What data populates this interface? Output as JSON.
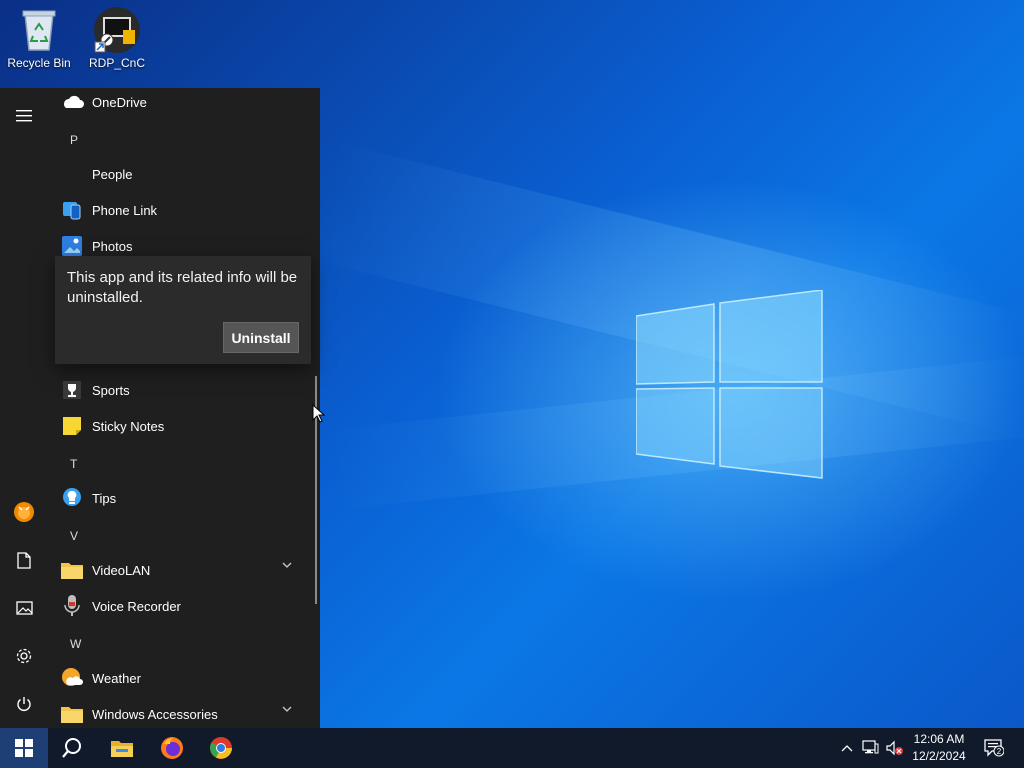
{
  "desktop": {
    "icons": [
      {
        "label": "Recycle Bin"
      },
      {
        "label": "RDP_CnC"
      }
    ]
  },
  "start_menu": {
    "items": {
      "onedrive": "OneDrive",
      "letter_p": "P",
      "people": "People",
      "phone_link": "Phone Link",
      "photos": "Photos",
      "sports": "Sports",
      "sticky_notes": "Sticky Notes",
      "letter_t": "T",
      "tips": "Tips",
      "letter_v": "V",
      "videolan": "VideoLAN",
      "voice_recorder": "Voice Recorder",
      "letter_w": "W",
      "weather": "Weather",
      "windows_accessories": "Windows Accessories"
    },
    "uninstall_flyout": {
      "message": "This app and its related info will be uninstalled.",
      "button_label": "Uninstall"
    }
  },
  "taskbar": {
    "clock": {
      "time": "12:06 AM",
      "date": "12/2/2024"
    },
    "notification_count": "2"
  },
  "colors": {
    "menu_bg": "#1f1f1f",
    "flyout_bg": "#2b2b2b",
    "taskbar_bg": "#101a2b",
    "accent": "#0b77e6"
  }
}
